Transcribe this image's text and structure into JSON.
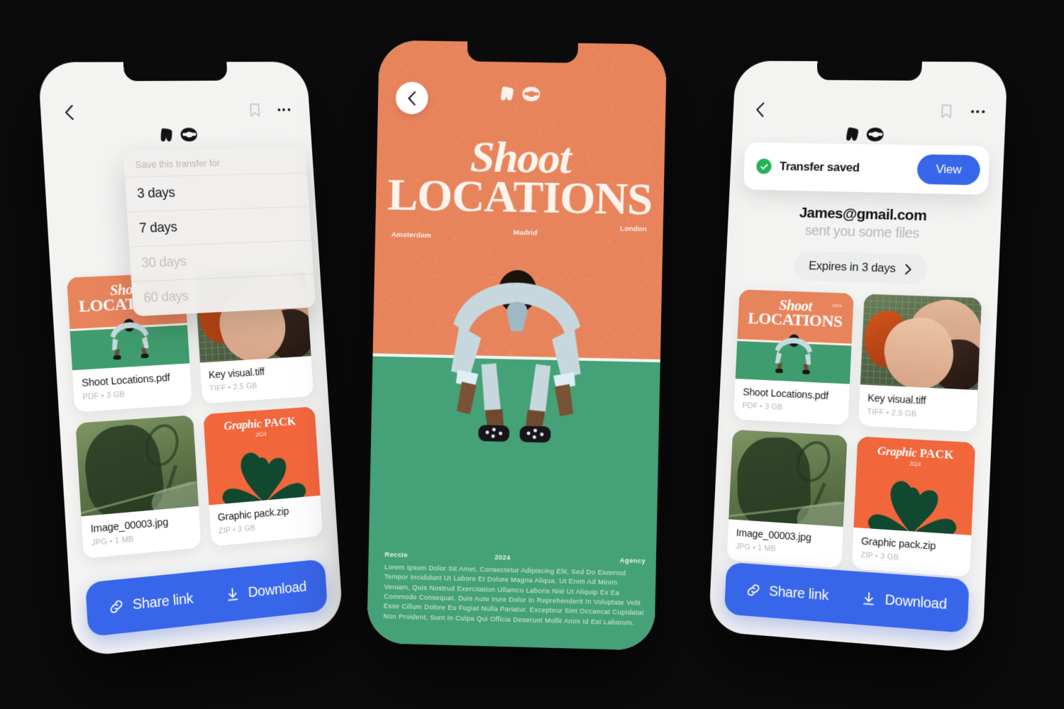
{
  "colors": {
    "background": "#0b0b0b",
    "screen": "#f3f3f2",
    "accent_blue": "#3866ea",
    "poster_orange": "#e8845c",
    "poster_green": "#45a177",
    "pack_orange": "#f2663c",
    "pack_green": "#10492f",
    "success_green": "#22b457"
  },
  "brand": {
    "logo": "we-logo",
    "logo_alt": "we"
  },
  "phone_left": {
    "topbar": {
      "back": "back-chevron-icon",
      "bookmark": "bookmark-icon",
      "more": "more-dots-icon"
    },
    "dropdown": {
      "header": "Save this transfer for",
      "options": [
        {
          "label": "3 days",
          "dimmed": false
        },
        {
          "label": "7 days",
          "dimmed": false
        },
        {
          "label": "30 days",
          "dimmed": true
        },
        {
          "label": "60 days",
          "dimmed": true
        }
      ]
    },
    "files": [
      {
        "name": "Shoot Locations.pdf",
        "meta": "PDF  •  3 GB",
        "art": "shoot"
      },
      {
        "name": "Key visual.tiff",
        "meta": "TIFF  •  2.5 GB",
        "art": "faces"
      },
      {
        "name": "Image_00003.jpg",
        "meta": "JPG  •  1 MB",
        "art": "shadow"
      },
      {
        "name": "Graphic pack.zip",
        "meta": "ZIP  •  3 GB",
        "art": "pack"
      }
    ],
    "actions": {
      "share_label": "Share link",
      "share_icon": "link-icon",
      "download_label": "Download",
      "download_icon": "download-icon"
    }
  },
  "phone_center": {
    "back": "back-chevron-icon",
    "poster": {
      "title_line1": "Shoot",
      "title_line2": "LOCATIONS",
      "cities": [
        "Amsterdam",
        "Madrid",
        "London"
      ],
      "credit_left": "Reccie",
      "credit_mid": "2024",
      "credit_right": "Agency",
      "body": "Lorem Ipsum Dolor Sit Amet, Consectetur Adipiscing Elit, Sed Do Eiusmod Tempor Incididunt Ut Labore Et Dolore Magna Aliqua. Ut Enim Ad Minim Veniam, Quis Nostrud Exercitation Ullamco Laboris Nisi Ut Aliquip Ex Ea Commodo Consequat. Duis Aute Irure Dolor In Reprehenderit In Voluptate Velit Esse Cillum Dolore Eu Fugiat Nulla Pariatur. Excepteur Sint Occaecat Cupidatat Non Proident, Sunt In Culpa Qui Officia Deserunt Mollit Anim Id Est Laborum."
    }
  },
  "phone_right": {
    "topbar": {
      "back": "back-chevron-icon",
      "bookmark": "bookmark-icon",
      "more": "more-dots-icon"
    },
    "toast": {
      "status_icon": "check-circle-icon",
      "label": "Transfer saved",
      "button": "View"
    },
    "sender": {
      "email": "James@gmail.com",
      "subtitle": "sent you some files"
    },
    "expires": {
      "label": "Expires in 3 days",
      "chevron": "chevron-right-icon"
    },
    "files": [
      {
        "name": "Shoot Locations.pdf",
        "meta": "PDF  •  3 GB",
        "art": "shoot"
      },
      {
        "name": "Key visual.tiff",
        "meta": "TIFF  •  2.5 GB",
        "art": "faces"
      },
      {
        "name": "Image_00003.jpg",
        "meta": "JPG  •  1 MB",
        "art": "shadow"
      },
      {
        "name": "Graphic pack.zip",
        "meta": "ZIP  •  3 GB",
        "art": "pack"
      }
    ],
    "actions": {
      "share_label": "Share link",
      "share_icon": "link-icon",
      "download_label": "Download",
      "download_icon": "download-icon"
    }
  },
  "thumb_art": {
    "shoot": {
      "line1": "Shoot",
      "line2": "LOCATIONS",
      "year": "2024"
    },
    "pack": {
      "title_italic": "Graphic",
      "title_bold": "PACK",
      "year": "2024"
    }
  }
}
